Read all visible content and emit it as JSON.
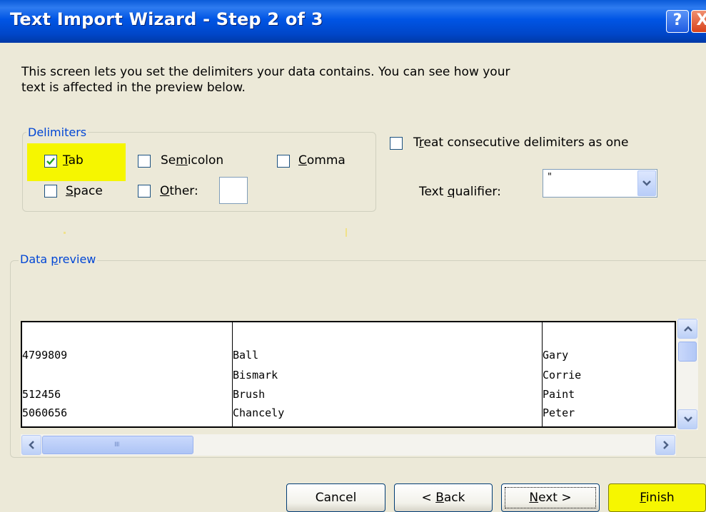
{
  "window": {
    "title": "Text Import Wizard - Step 2 of 3",
    "help_glyph": "?",
    "close_glyph": "X"
  },
  "intro": {
    "text": "This screen lets you set the delimiters your data contains.  You can see how your text is affected in the preview below."
  },
  "delimiters": {
    "legend": "Delimiters",
    "tab": {
      "pre": "",
      "accel": "T",
      "post": "ab",
      "checked": true
    },
    "semicolon": {
      "pre": "Se",
      "accel": "m",
      "post": "icolon",
      "checked": false
    },
    "comma": {
      "pre": "",
      "accel": "C",
      "post": "omma",
      "checked": false
    },
    "space": {
      "pre": "",
      "accel": "S",
      "post": "pace",
      "checked": false
    },
    "other": {
      "pre": "",
      "accel": "O",
      "post": "ther:",
      "checked": false
    },
    "other_value": ""
  },
  "options": {
    "consecutive": {
      "pre": "T",
      "accel": "r",
      "post": "eat consecutive delimiters as one",
      "checked": false
    },
    "qualifier_label": {
      "pre": "Text ",
      "accel": "q",
      "post": "ualifier:"
    },
    "qualifier_value": "\""
  },
  "preview": {
    "legend_pre": "Data ",
    "legend_accel": "p",
    "legend_post": "review",
    "rows": [
      [
        "4799809",
        "Ball",
        "Gary"
      ],
      [
        "",
        "Bismark",
        "Corrie"
      ],
      [
        "512456",
        "Brush",
        "Paint"
      ],
      [
        "5060656",
        "Chancely",
        "Peter"
      ]
    ],
    "scroll_grip": "IIII"
  },
  "buttons": {
    "cancel": "Cancel",
    "back": {
      "pre": "< ",
      "accel": "B",
      "post": "ack"
    },
    "next": {
      "pre": "",
      "accel": "N",
      "post": "ext >"
    },
    "finish": {
      "pre": "",
      "accel": "F",
      "post": "inish"
    }
  },
  "colors": {
    "highlight": "#f6f600",
    "titlebar": "#0055e5",
    "legend": "#0046d5",
    "dialog": "#ece9d8"
  }
}
